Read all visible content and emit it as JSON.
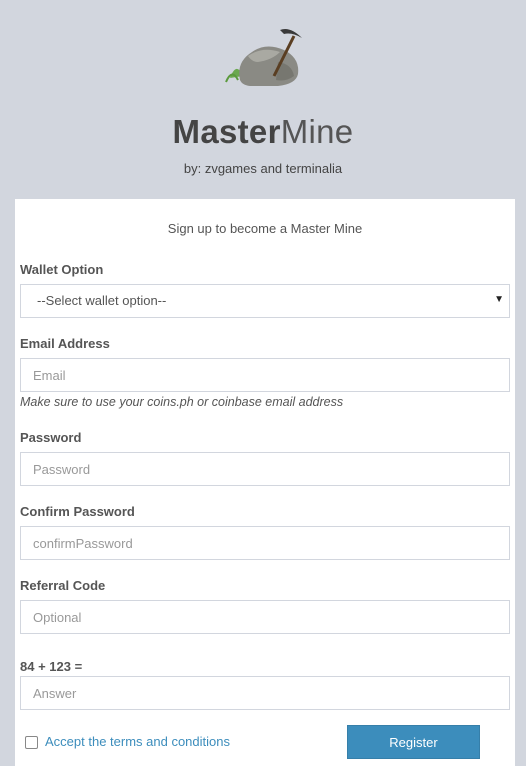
{
  "header": {
    "brand_bold": "Master",
    "brand_light": "Mine",
    "byline": "by: zvgames and terminalia",
    "logo_icon": "rock-pickaxe-icon"
  },
  "form": {
    "intro": "Sign up to become a Master Mine",
    "wallet": {
      "label": "Wallet Option",
      "selected": "--Select wallet option--"
    },
    "email": {
      "label": "Email Address",
      "placeholder": "Email",
      "hint": "Make sure to use your coins.ph or coinbase email address"
    },
    "password": {
      "label": "Password",
      "placeholder": "Password"
    },
    "confirm": {
      "label": "Confirm Password",
      "placeholder": "confirmPassword"
    },
    "referral": {
      "label": "Referral Code",
      "placeholder": "Optional"
    },
    "captcha": {
      "label": "84 + 123 =",
      "placeholder": "Answer"
    },
    "terms_label": "Accept the terms and conditions",
    "register_label": "Register"
  },
  "colors": {
    "background": "#d2d6de",
    "accent": "#3c8dbc",
    "link": "#3c8dbc"
  }
}
